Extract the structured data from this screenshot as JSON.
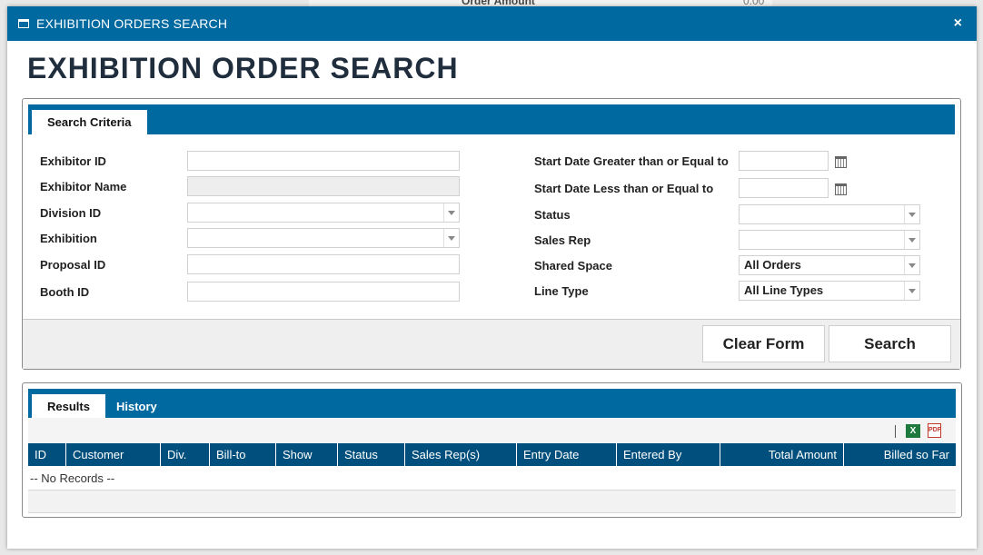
{
  "window": {
    "title": "EXHIBITION ORDERS SEARCH",
    "close_glyph": "×"
  },
  "heading": "EXHIBITION ORDER SEARCH",
  "background": {
    "column_label": "Order Amount",
    "amount": "0.00"
  },
  "criteria": {
    "tab_label": "Search Criteria",
    "left_fields": [
      {
        "label": "Exhibitor ID",
        "value": "",
        "type": "text"
      },
      {
        "label": "Exhibitor Name",
        "value": "",
        "type": "text-disabled"
      },
      {
        "label": "Division ID",
        "value": "",
        "type": "select"
      },
      {
        "label": "Exhibition",
        "value": "",
        "type": "select"
      },
      {
        "label": "Proposal ID",
        "value": "",
        "type": "text"
      },
      {
        "label": "Booth ID",
        "value": "",
        "type": "text"
      }
    ],
    "right_fields": [
      {
        "label": "Start Date Greater than or Equal to",
        "value": "",
        "type": "date"
      },
      {
        "label": "Start Date Less than or Equal to",
        "value": "",
        "type": "date"
      },
      {
        "label": "Status",
        "value": "",
        "type": "select"
      },
      {
        "label": "Sales Rep",
        "value": "",
        "type": "select"
      },
      {
        "label": "Shared Space",
        "value": "All Orders",
        "type": "select"
      },
      {
        "label": "Line Type",
        "value": "All Line Types",
        "type": "select"
      }
    ],
    "clear_label": "Clear Form",
    "search_label": "Search"
  },
  "results": {
    "tabs": [
      "Results",
      "History"
    ],
    "active_tab": "Results",
    "export": {
      "excel_icon": "excel-icon",
      "pdf_icon": "pdf-icon",
      "excel_glyph": "X",
      "pdf_glyph": "PDF"
    },
    "columns": [
      "ID",
      "Customer",
      "Div.",
      "Bill-to",
      "Show",
      "Status",
      "Sales Rep(s)",
      "Entry Date",
      "Entered By",
      "Total Amount",
      "Billed so Far"
    ],
    "empty_text": "-- No Records --"
  },
  "colors": {
    "title_bar": "#0069a0",
    "grid_header": "#004f7c"
  }
}
